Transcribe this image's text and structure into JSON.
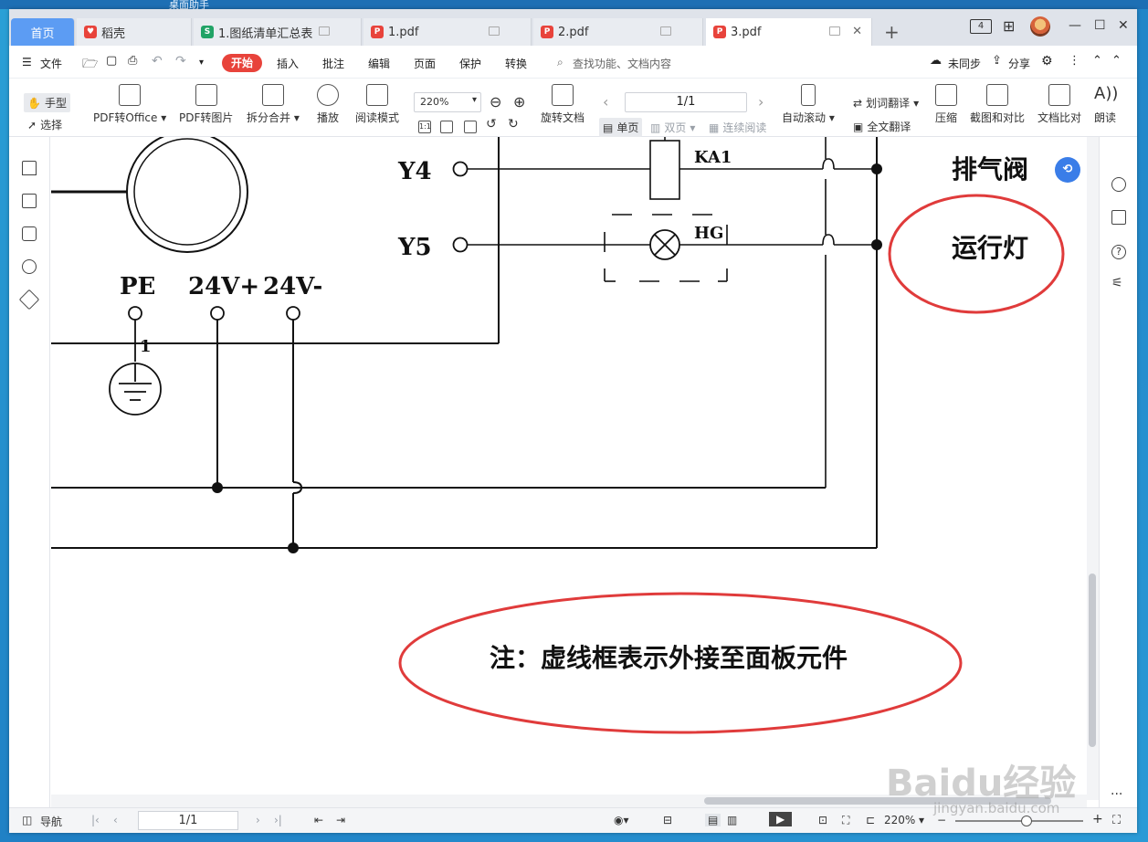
{
  "desktop": {
    "title": "桌面助手"
  },
  "tabs": [
    {
      "label": "首页"
    },
    {
      "label": "稻壳",
      "icon_color": "#e8433b",
      "glyph": "稻"
    },
    {
      "label": "1.图纸清单汇总表",
      "icon_color": "#21a366",
      "glyph": "S"
    },
    {
      "label": "1.pdf",
      "icon_color": "#e8433b",
      "glyph": "P"
    },
    {
      "label": "2.pdf",
      "icon_color": "#e8433b",
      "glyph": "P"
    },
    {
      "label": "3.pdf",
      "icon_color": "#e8433b",
      "glyph": "P"
    }
  ],
  "window_controls": {
    "badge": "4",
    "minimize": "—",
    "restore": "☐",
    "close": "✕"
  },
  "menu": {
    "file": "文件",
    "start": "开始",
    "items": [
      "插入",
      "批注",
      "编辑",
      "页面",
      "保护",
      "转换"
    ],
    "search": "查找功能、文档内容",
    "sync": "未同步",
    "share": "分享"
  },
  "ribbon": {
    "hand": "手型",
    "select": "选择",
    "pdf_to_office": "PDF转Office",
    "pdf_to_image": "PDF转图片",
    "split_merge": "拆分合并",
    "play": "播放",
    "read_mode": "阅读模式",
    "zoom": "220%",
    "rotate": "旋转文档",
    "page": "1/1",
    "single": "单页",
    "double": "双页",
    "continuous": "连续阅读",
    "auto_scroll": "自动滚动",
    "word_translate": "划词翻译",
    "full_translate": "全文翻译",
    "compress": "压缩",
    "screenshot_compare": "截图和对比",
    "doc_compare": "文档比对",
    "read_aloud": "朗读"
  },
  "drawing": {
    "y4": "Y4",
    "y5": "Y5",
    "ka1": "KA1",
    "hg": "HG",
    "pe": "PE",
    "v24p": "24V+",
    "v24n": "24V-",
    "wire_num": "1",
    "exhaust_valve": "排气阀",
    "run_light": "运行灯",
    "note": "注：虚线框表示外接至面板元件",
    "annotation_color": "#e03b3b"
  },
  "statusbar": {
    "nav": "导航",
    "page": "1/1",
    "zoom": "220%"
  },
  "watermark": {
    "main": "Baidu经验",
    "sub": "jingyan.baidu.com"
  }
}
